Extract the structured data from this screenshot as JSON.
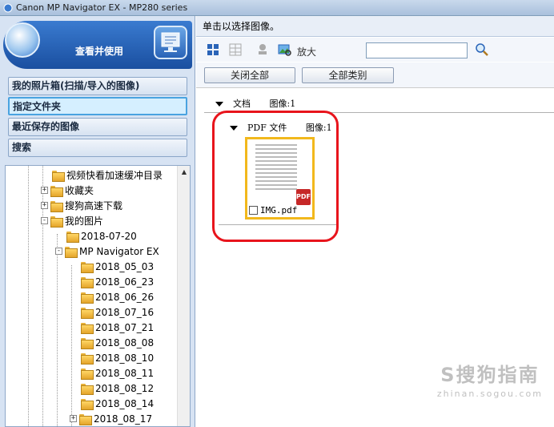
{
  "window": {
    "title": "Canon MP Navigator EX - MP280 series"
  },
  "left_panel": {
    "header_title": "查看并使用",
    "nav": [
      {
        "label": "我的照片箱(扫描/导入的图像)",
        "active": false
      },
      {
        "label": "指定文件夹",
        "active": true
      },
      {
        "label": "最近保存的图像",
        "active": false
      },
      {
        "label": "搜索",
        "active": false
      }
    ],
    "tree": [
      {
        "label": "视频快看加速缓冲目录",
        "expander": ""
      },
      {
        "label": "收藏夹",
        "expander": "+"
      },
      {
        "label": "搜狗高速下载",
        "expander": "+"
      },
      {
        "label": "我的图片",
        "expander": "-"
      },
      {
        "label": "2018-07-20",
        "expander": ""
      },
      {
        "label": "MP Navigator EX",
        "expander": "-"
      },
      {
        "label": "2018_05_03",
        "expander": ""
      },
      {
        "label": "2018_06_23",
        "expander": ""
      },
      {
        "label": "2018_06_26",
        "expander": ""
      },
      {
        "label": "2018_07_16",
        "expander": ""
      },
      {
        "label": "2018_07_21",
        "expander": ""
      },
      {
        "label": "2018_08_08",
        "expander": ""
      },
      {
        "label": "2018_08_10",
        "expander": ""
      },
      {
        "label": "2018_08_11",
        "expander": ""
      },
      {
        "label": "2018_08_12",
        "expander": ""
      },
      {
        "label": "2018_08_14",
        "expander": ""
      },
      {
        "label": "2018_08_17",
        "expander": "+"
      }
    ]
  },
  "main": {
    "hint": "单击以选择图像。",
    "toolbar": {
      "zoom_label": "放大",
      "search_value": ""
    },
    "buttons": {
      "close_all": "关闭全部",
      "all_categories": "全部类别"
    },
    "section_document": {
      "label": "文档",
      "count": "图像:1"
    },
    "section_pdf": {
      "label": "PDF 文件",
      "count": "图像:1"
    },
    "thumbnail": {
      "filename": "IMG.pdf",
      "badge": "PDF"
    }
  },
  "watermark": {
    "line1": "S搜狗指南",
    "line2": "zhinan.sogou.com"
  }
}
